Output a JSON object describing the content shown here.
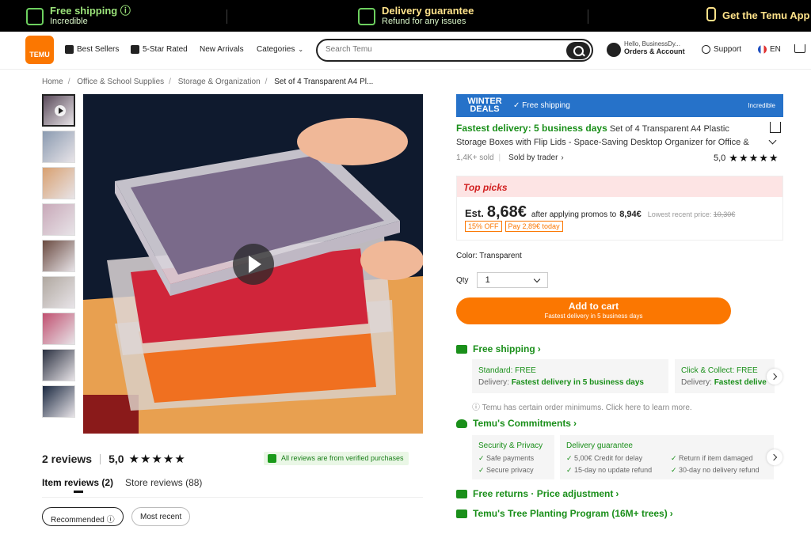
{
  "promo_bar": {
    "free_shipping": {
      "title": "Free shipping ⓘ",
      "subtitle": "Incredible"
    },
    "delivery": {
      "title": "Delivery guarantee",
      "subtitle": "Refund for any issues"
    },
    "app": {
      "title": "Get the Temu App"
    }
  },
  "header": {
    "logo_text": "TEMU",
    "nav": [
      "Best Sellers",
      "5-Star Rated",
      "New Arrivals",
      "Categories"
    ],
    "search_placeholder": "Search Temu",
    "account": {
      "greeting": "Hello, BusinessDy...",
      "label": "Orders & Account"
    },
    "support": "Support",
    "language": "EN"
  },
  "breadcrumb": [
    "Home",
    "Office & School Supplies",
    "Storage & Organization",
    "Set of 4 Transparent A4 Pl..."
  ],
  "thumb_colors": [
    "#5a4a5a",
    "#8a9ab0",
    "#d8a070",
    "#c8a8b8",
    "#6a4a40",
    "#b0a8a0",
    "#c05070",
    "#2a3040",
    "#1a2840"
  ],
  "reviews": {
    "count": "2 reviews",
    "score": "5,0",
    "stars": "★★★★★",
    "verified": "All reviews are from verified purchases",
    "tabs": [
      "Item reviews (2)",
      "Store reviews (88)"
    ],
    "sort": [
      "Recommended ⓘ",
      "Most recent"
    ]
  },
  "product": {
    "banner": {
      "deals": "WINTER DEALS",
      "free_shipping": "Free shipping",
      "incredible": "Incredible"
    },
    "fast_delivery": "Fastest delivery: 5 business days",
    "title": "Set of 4 Transparent A4 Plastic Storage Boxes with Flip Lids - Space-Saving Desktop Organizer for Office &",
    "sold": "1,4K+ sold",
    "sold_by": "Sold by trader",
    "rating": "5,0",
    "stars": "★★★★★",
    "top_picks": "Top picks",
    "est": "Est.",
    "price_main": "8,68€",
    "after_promo": "after applying promos to",
    "promo_price": "8,94€",
    "lowest_label": "Lowest recent price:",
    "lowest_price": "10,30€",
    "badge_off": "15% OFF",
    "badge_pay": "Pay 2,89€ today",
    "color": "Color: Transparent",
    "qty_label": "Qty",
    "qty_value": "1",
    "cart_title": "Add to cart",
    "cart_sub": "Fastest delivery in 5 business days"
  },
  "shipping": {
    "title": "Free shipping",
    "standard_label": "Standard: FREE",
    "standard_delivery_label": "Delivery:",
    "standard_delivery": "Fastest delivery in 5 business days",
    "click_label": "Click & Collect: FREE",
    "click_delivery_label": "Delivery:",
    "click_delivery": "Fastest delive",
    "min_order": "ⓘ Temu has certain order minimums. Click here to learn more."
  },
  "commitments": {
    "title": "Temu's Commitments",
    "security": {
      "title": "Security & Privacy",
      "items": [
        "Safe payments",
        "Secure privacy"
      ]
    },
    "delivery": {
      "title": "Delivery guarantee",
      "items": [
        "5,00€ Credit for delay",
        "15-day no update refund",
        "Return if item damaged",
        "30-day no delivery refund"
      ]
    }
  },
  "links": {
    "returns": "Free returns · Price adjustment",
    "tree": "Temu's Tree Planting Program (16M+ trees)"
  }
}
